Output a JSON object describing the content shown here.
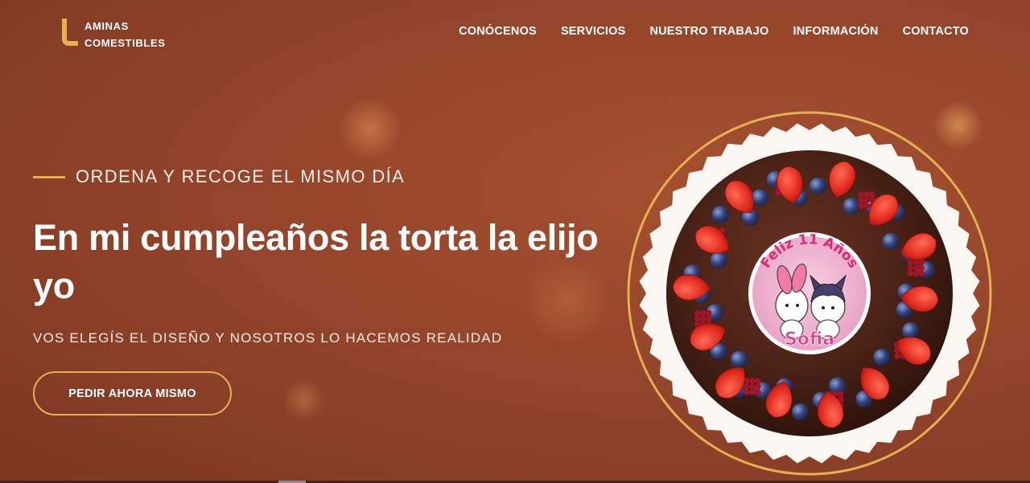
{
  "brand": {
    "line1": "AMINAS",
    "line2": "COMESTIBLES"
  },
  "nav": [
    {
      "label": "CONÓCENOS"
    },
    {
      "label": "SERVICIOS"
    },
    {
      "label": "NUESTRO TRABAJO"
    },
    {
      "label": "INFORMACIÓN"
    },
    {
      "label": "CONTACTO"
    }
  ],
  "hero": {
    "eyebrow": "ORDENA Y RECOGE EL MISMO DÍA",
    "headline": "En mi cumpleaños la torta la elijo yo",
    "subline": "VOS ELEGÍS EL DISEÑO Y NOSOTROS LO HACEMOS REALIDAD",
    "cta": "PEDIR AHORA MISMO"
  },
  "cake": {
    "topper_line1": "Feliz 11 Años",
    "topper_line2": "Sofia"
  },
  "colors": {
    "accent": "#e3b150",
    "background": "#9a4a2c",
    "chocolate": "#4b2317"
  }
}
